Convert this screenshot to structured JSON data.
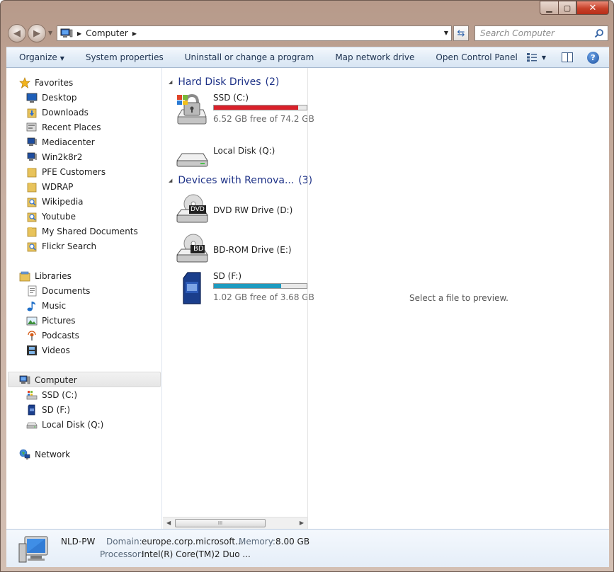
{
  "window": {
    "caption": {
      "minimize": "▁",
      "maximize": "▢",
      "close": "✕"
    }
  },
  "address": {
    "location": "Computer",
    "search_placeholder": "Search Computer"
  },
  "toolbar": {
    "organize": "Organize",
    "system_properties": "System properties",
    "uninstall": "Uninstall or change a program",
    "map_drive": "Map network drive",
    "control_panel": "Open Control Panel"
  },
  "navpane": {
    "favorites": {
      "label": "Favorites",
      "items": [
        "Desktop",
        "Downloads",
        "Recent Places",
        "Mediacenter",
        "Win2k8r2",
        "PFE Customers",
        "WDRAP",
        "Wikipedia",
        "Youtube",
        "My Shared Documents",
        "Flickr Search"
      ]
    },
    "libraries": {
      "label": "Libraries",
      "items": [
        "Documents",
        "Music",
        "Pictures",
        "Podcasts",
        "Videos"
      ]
    },
    "computer": {
      "label": "Computer",
      "items": [
        "SSD (C:)",
        "SD (F:)",
        "Local Disk (Q:)"
      ]
    },
    "network": {
      "label": "Network"
    }
  },
  "content": {
    "groups": [
      {
        "title": "Hard Disk Drives",
        "count": "(2)"
      },
      {
        "title": "Devices with Remova...",
        "count": "(3)"
      }
    ],
    "drives": [
      {
        "name": "SSD (C:)",
        "free": "6.52 GB free of 74.2 GB",
        "used_fraction": 0.912,
        "bar_color": "#d9202a"
      },
      {
        "name": "Local Disk (Q:)"
      },
      {
        "name": "DVD RW Drive (D:)",
        "badge": "DVD"
      },
      {
        "name": "BD-ROM Drive (E:)",
        "badge": "BD"
      },
      {
        "name": "SD (F:)",
        "free": "1.02 GB free of 3.68 GB",
        "used_fraction": 0.723,
        "bar_color": "#1d9bc0"
      }
    ],
    "scroll_grip": "III"
  },
  "preview": {
    "message": "Select a file to preview."
  },
  "details": {
    "name": "NLD-PW",
    "domain_label": "Domain:",
    "domain": "europe.corp.microsoft....",
    "memory_label": "Memory:",
    "memory": "8.00 GB",
    "processor_label": "Processor:",
    "processor": "Intel(R) Core(TM)2 Duo ..."
  }
}
